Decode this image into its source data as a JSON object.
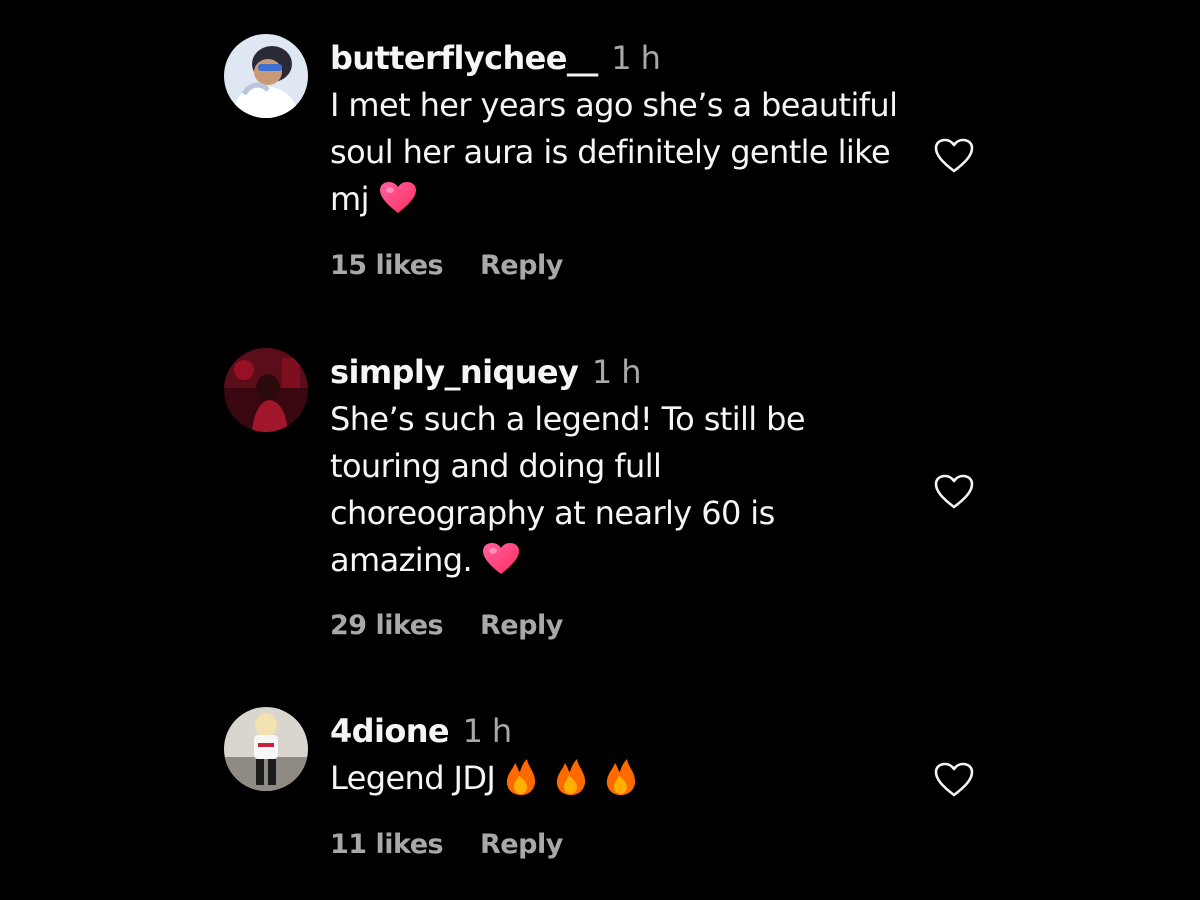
{
  "colors": {
    "background": "#000000",
    "primary_text": "#f5f5f5",
    "secondary_text": "#a8a8a8",
    "heart_emoji": "#ff3d7a",
    "fire_emoji": "#ff8a00"
  },
  "comments": [
    {
      "username": "butterflychee__",
      "time": "1 h",
      "text_lines": [
        "I met her years ago she’s a beautiful",
        "soul her aura is definitely gentle like",
        "mj"
      ],
      "trailing_emojis": [
        "heart-emoji"
      ],
      "likes": "15 likes",
      "reply_label": "Reply",
      "like_icon": "heart-outline-icon"
    },
    {
      "username": "simply_niquey",
      "time": "1 h",
      "text_lines": [
        "She’s such a legend! To still be",
        "touring and doing full",
        "choreography at nearly 60 is",
        "amazing."
      ],
      "trailing_emojis": [
        "heart-emoji"
      ],
      "likes": "29 likes",
      "reply_label": "Reply",
      "like_icon": "heart-outline-icon"
    },
    {
      "username": "4dione",
      "time": "1 h",
      "text_lines": [
        "Legend JDJ"
      ],
      "trailing_emojis": [
        "fire-emoji",
        "fire-emoji",
        "fire-emoji"
      ],
      "likes": "11 likes",
      "reply_label": "Reply",
      "like_icon": "heart-outline-icon"
    }
  ]
}
